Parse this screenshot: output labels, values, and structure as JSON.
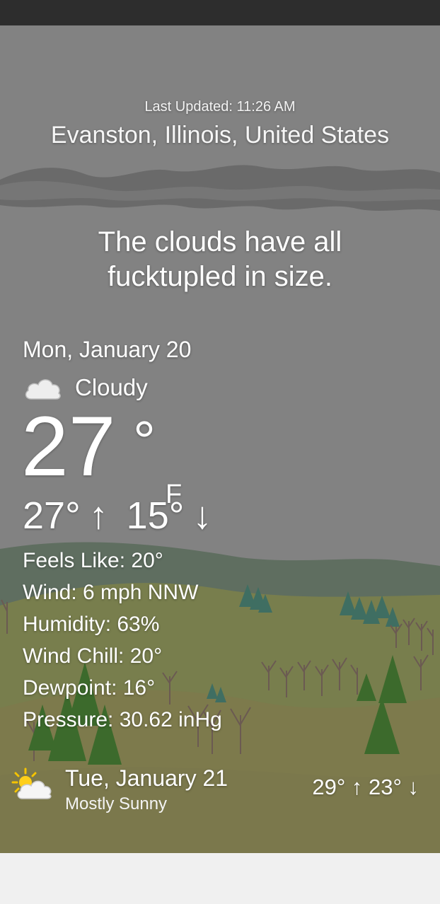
{
  "header": {
    "last_updated": "Last Updated: 11:26 AM",
    "location": "Evanston, Illinois, United States"
  },
  "headline": "The clouds have all fucktupled in size.",
  "today": {
    "date": "Mon, January 20",
    "condition": "Cloudy",
    "condition_icon": "cloud-icon",
    "temperature": "27",
    "degree_symbol": "°",
    "unit": "F",
    "high": "27°",
    "high_arrow": "↑",
    "low": "15°",
    "low_arrow": "↓",
    "details": {
      "feels_like": "Feels Like: 20°",
      "wind": "Wind: 6 mph NNW",
      "humidity": "Humidity: 63%",
      "wind_chill": "Wind Chill: 20°",
      "dewpoint": "Dewpoint: 16°",
      "pressure": "Pressure: 30.62 inHg"
    }
  },
  "forecast": [
    {
      "date": "Tue, January 21",
      "condition": "Mostly Sunny",
      "condition_icon": "sun-cloud-icon",
      "hilo": "29° ↑ 23° ↓"
    }
  ],
  "colors": {
    "sky": "#828282",
    "status_bar": "#2d2d2d",
    "hill_far": "#5f6e60",
    "hill_mid": "#787e4d",
    "hill_near": "#7d7a4c",
    "tree_green": "#3c6a2c"
  }
}
